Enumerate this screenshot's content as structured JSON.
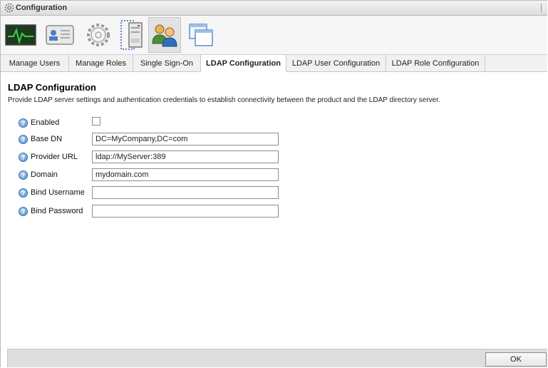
{
  "window": {
    "title": "Configuration",
    "icon": "gear-icon"
  },
  "toolbar": {
    "buttons": [
      {
        "name": "monitor-icon",
        "selected": false
      },
      {
        "name": "id-card-icon",
        "selected": false
      },
      {
        "name": "gear-icon",
        "selected": false
      },
      {
        "name": "server-icon",
        "selected": false
      },
      {
        "name": "users-icon",
        "selected": true
      },
      {
        "name": "windows-icon",
        "selected": false
      }
    ]
  },
  "tabs": [
    {
      "label": "Manage Users",
      "active": false
    },
    {
      "label": "Manage Roles",
      "active": false
    },
    {
      "label": "Single Sign-On",
      "active": false
    },
    {
      "label": "LDAP Configuration",
      "active": true
    },
    {
      "label": "LDAP User Configuration",
      "active": false
    },
    {
      "label": "LDAP Role Configuration",
      "active": false
    }
  ],
  "panel": {
    "title": "LDAP Configuration",
    "description": "Provide LDAP server settings and authentication credentials to establish connectivity between the product and the LDAP directory server."
  },
  "fields": {
    "enabled": {
      "label": "Enabled",
      "checked": false
    },
    "base_dn": {
      "label": "Base DN",
      "value": "DC=MyCompany,DC=com"
    },
    "provider_url": {
      "label": "Provider URL",
      "value": "ldap://MyServer:389"
    },
    "domain": {
      "label": "Domain",
      "value": "mydomain.com"
    },
    "bind_username": {
      "label": "Bind Username",
      "value": ""
    },
    "bind_password": {
      "label": "Bind Password",
      "value": ""
    }
  },
  "footer": {
    "ok_label": "OK"
  },
  "colors": {
    "help_icon": "#4a89c6",
    "monitor_screen": "#1d3a1d",
    "monitor_trace": "#39d34a"
  }
}
